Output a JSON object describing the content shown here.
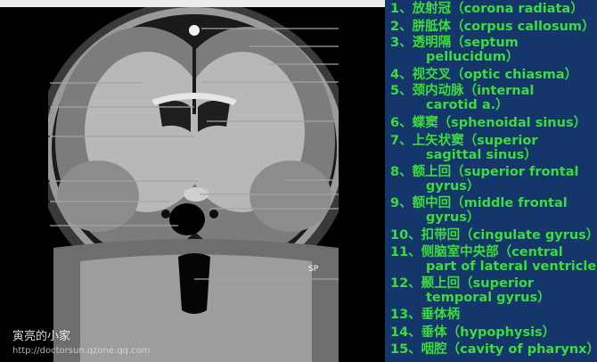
{
  "numbers": [
    "1",
    "2",
    "3",
    "4",
    "5",
    "6",
    "7",
    "8",
    "9",
    "10",
    "11",
    "12",
    "13",
    "14",
    "15"
  ],
  "sp_label": "SP",
  "legend": [
    {
      "line1": "1、放射冠（corona radiata）",
      "line2": ""
    },
    {
      "line1": "2、胼胝体（corpus callosum）",
      "line2": ""
    },
    {
      "line1": "3、透明隔（septum",
      "line2": "pellucidum）"
    },
    {
      "line1": "4、视交叉（optic chiasma）",
      "line2": ""
    },
    {
      "line1": "5、颈内动脉（internal",
      "line2": "carotid a.）"
    },
    {
      "line1": "6、蝶窦（sphenoidal sinus）",
      "line2": ""
    },
    {
      "line1": "7、上矢状窦（superior",
      "line2": "sagittal sinus）"
    },
    {
      "line1": "8、额上回（superior frontal",
      "line2": "gyrus）"
    },
    {
      "line1": "9、额中回（middle frontal",
      "line2": "gyrus）"
    },
    {
      "line1": "10、扣带回（cingulate gyrus）",
      "line2": ""
    },
    {
      "line1": "11、侧脑室中央部（central",
      "line2": "part of lateral ventricle）"
    },
    {
      "line1": "12、颞上回（superior",
      "line2": "temporal gyrus）"
    },
    {
      "line1": "13、垂体柄",
      "line2": ""
    },
    {
      "line1": "14、垂体（hypophysis）",
      "line2": ""
    },
    {
      "line1": "15、咽腔（cavity of pharynx）",
      "line2": ""
    }
  ],
  "watermark": {
    "line1": "寅亮的小家",
    "line2": "http://doctorsun.qzone.qq.com"
  }
}
